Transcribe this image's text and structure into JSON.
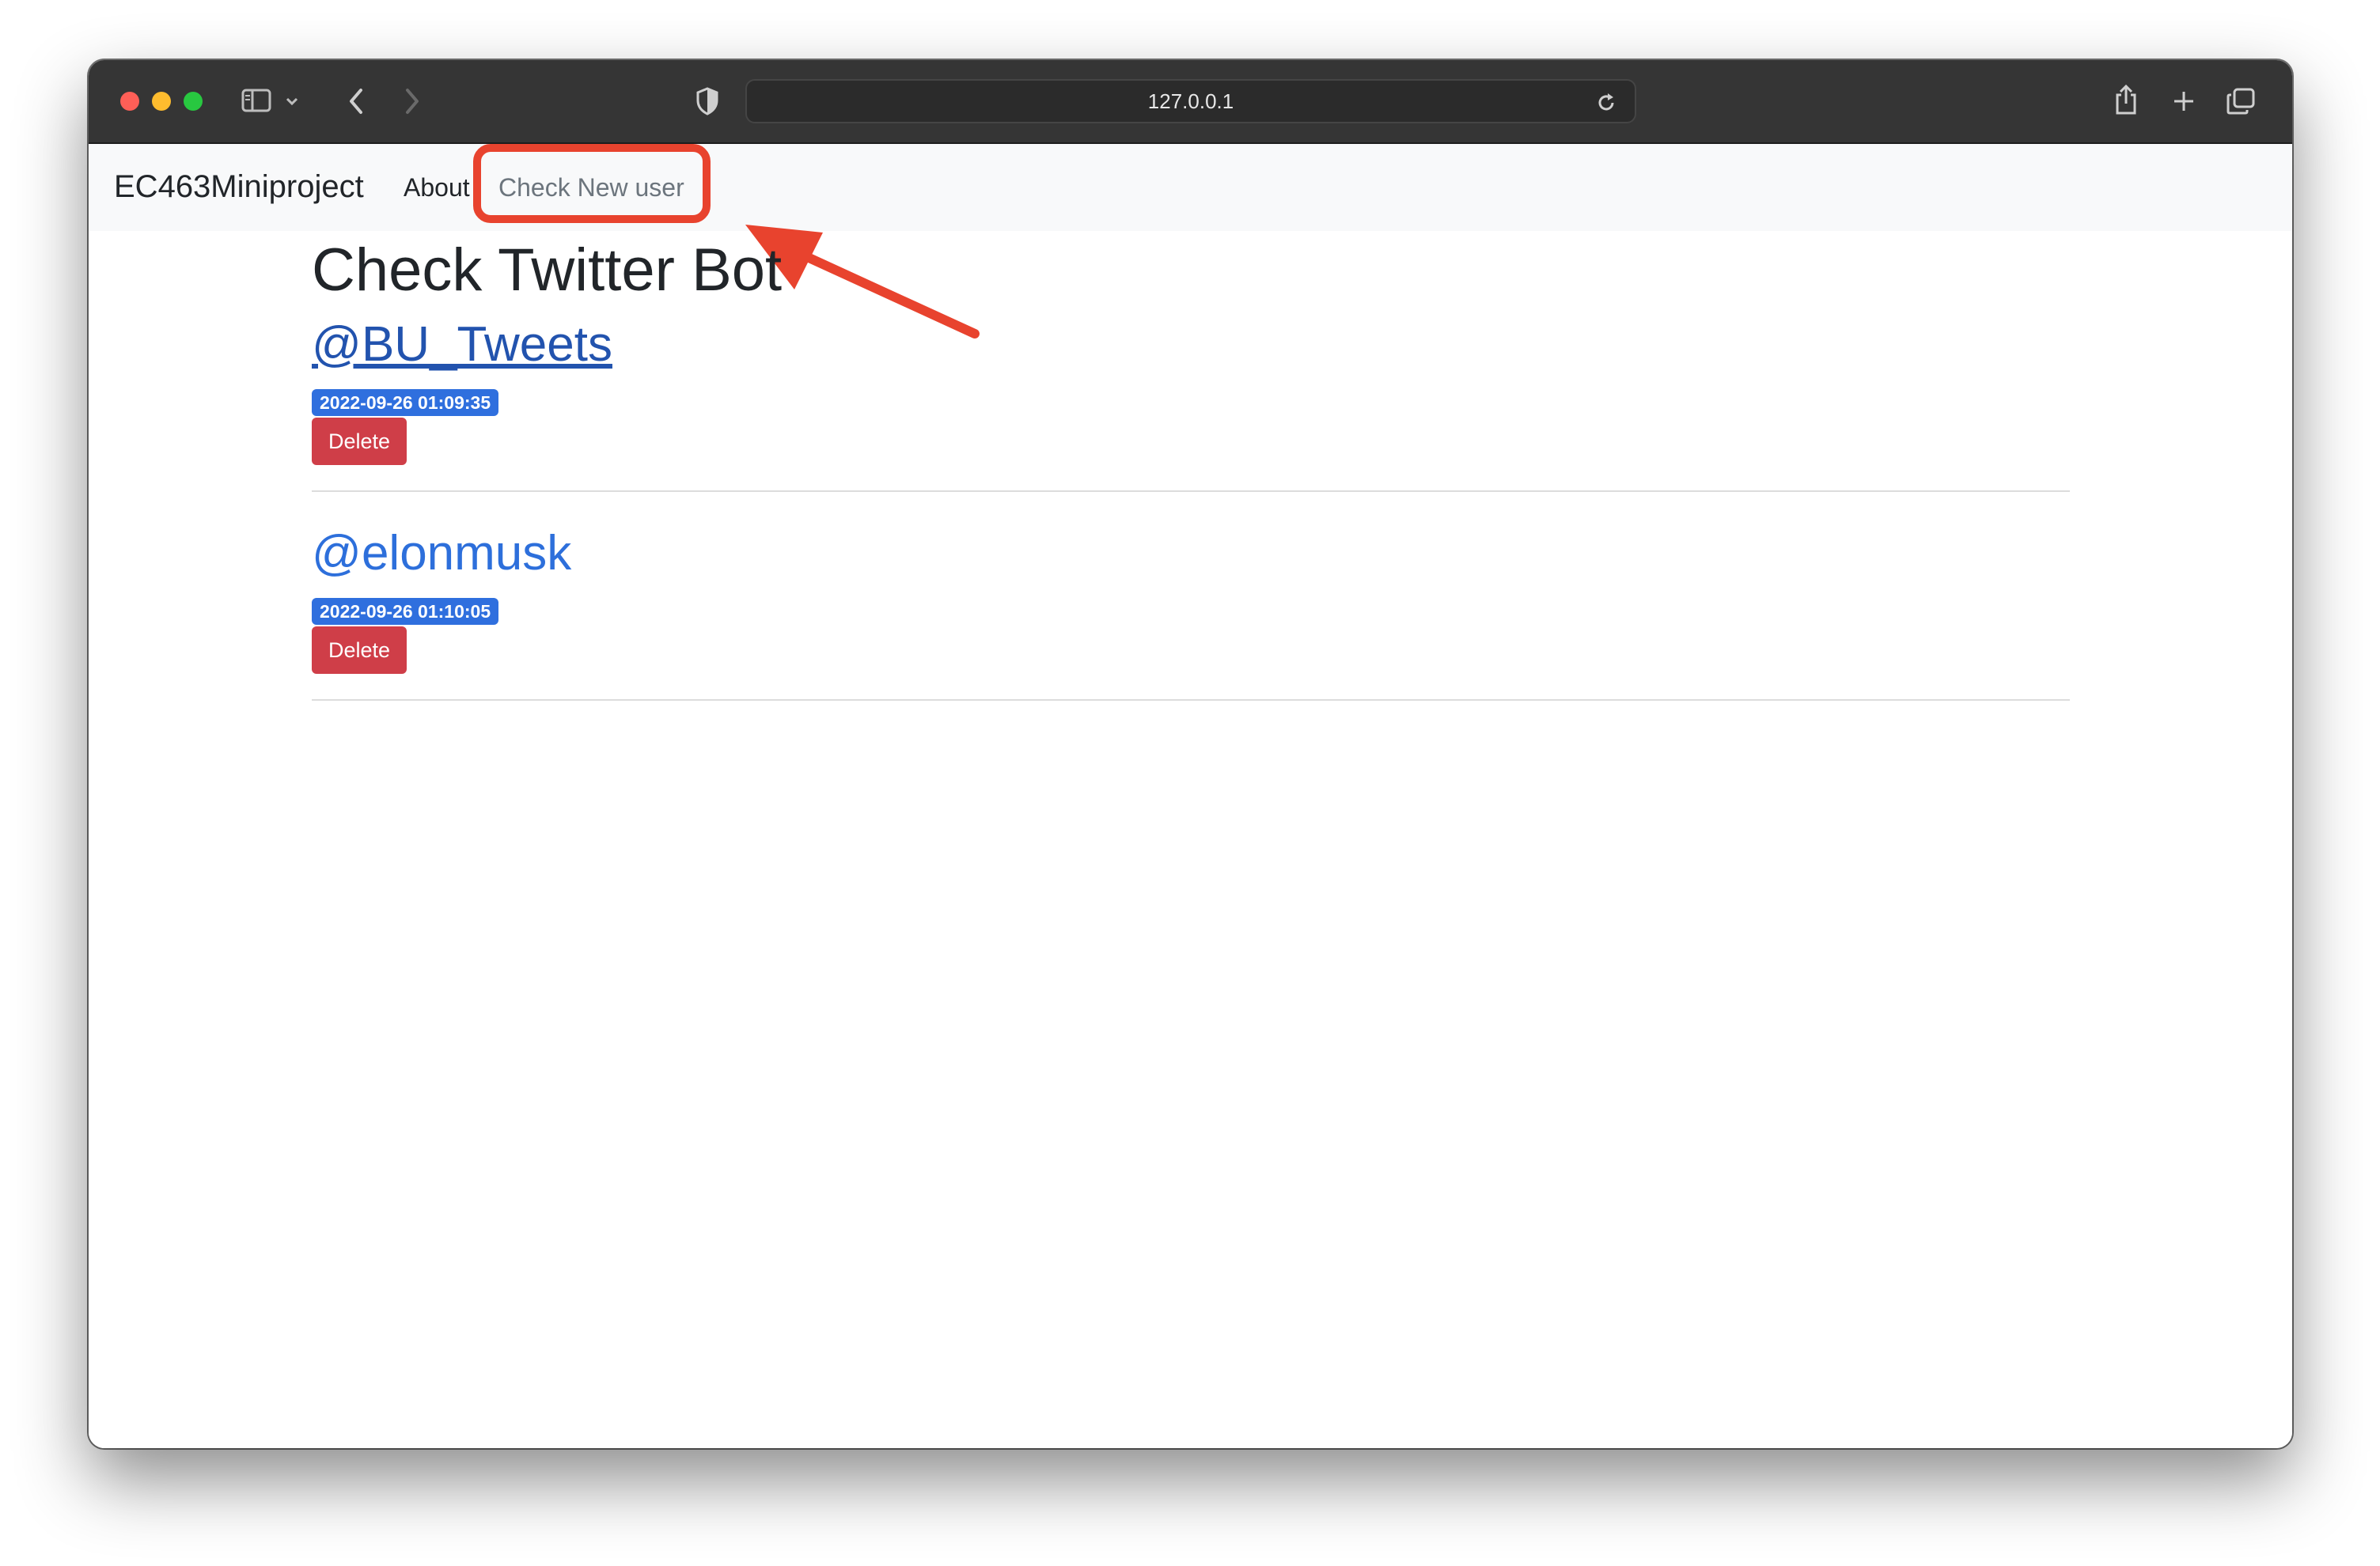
{
  "browser": {
    "address": "127.0.0.1"
  },
  "navbar": {
    "brand": "EC463Miniproject",
    "about": "About",
    "check_new_user": "Check New user"
  },
  "main": {
    "title": "Check Twitter Bot",
    "users": [
      {
        "handle": "@BU_Tweets",
        "timestamp": "2022-09-26 01:09:35",
        "delete_label": "Delete"
      },
      {
        "handle": "@elonmusk",
        "timestamp": "2022-09-26 01:10:05",
        "delete_label": "Delete"
      }
    ]
  },
  "colors": {
    "annotation": "#e8432e",
    "link": "#2d6fdb",
    "badge": "#2f6fde",
    "danger": "#cf3e48"
  }
}
